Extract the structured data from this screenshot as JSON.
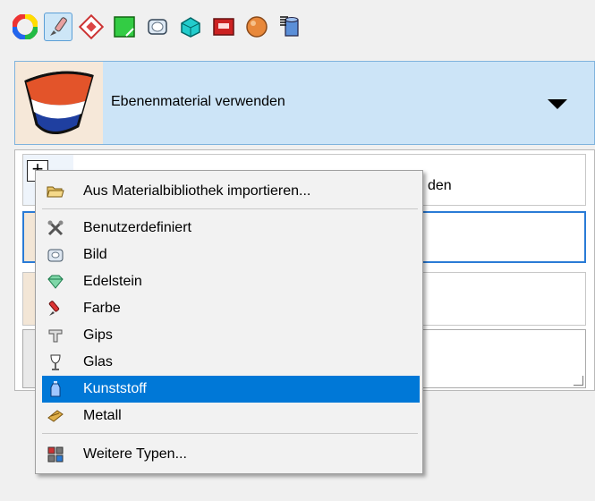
{
  "toolbar": {
    "buttons": [
      {
        "icon": "color-wheel-icon"
      },
      {
        "icon": "paint-brush-icon",
        "active": true
      },
      {
        "icon": "texture-pattern-icon"
      },
      {
        "icon": "green-surface-icon"
      },
      {
        "icon": "glass-object-icon"
      },
      {
        "icon": "cyan-shape-icon"
      },
      {
        "icon": "red-box-icon"
      },
      {
        "icon": "orange-sphere-icon"
      },
      {
        "icon": "database-icon"
      }
    ]
  },
  "material_selector": {
    "label": "Ebenenmaterial verwenden"
  },
  "list": {
    "row1_visible_text": "den"
  },
  "context_menu": {
    "import_label": "Aus Materialbibliothek importieren...",
    "items": [
      {
        "label": "Benutzerdefiniert",
        "icon": "tools-icon"
      },
      {
        "label": "Bild",
        "icon": "picture-icon"
      },
      {
        "label": "Edelstein",
        "icon": "gem-icon"
      },
      {
        "label": "Farbe",
        "icon": "paint-icon"
      },
      {
        "label": "Gips",
        "icon": "plaster-icon"
      },
      {
        "label": "Glas",
        "icon": "wine-glass-icon"
      },
      {
        "label": "Kunststoff",
        "icon": "plastic-bottle-icon",
        "highlighted": true
      },
      {
        "label": "Metall",
        "icon": "metal-icon"
      }
    ],
    "more_label": "Weitere Typen..."
  },
  "colors": {
    "accent": "#0078d7",
    "selection_panel": "#cce4f7"
  }
}
